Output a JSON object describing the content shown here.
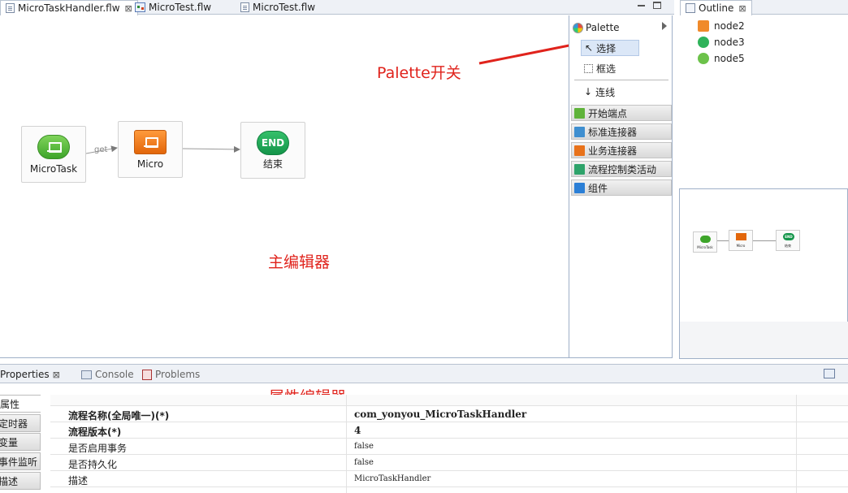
{
  "editor_tabs": [
    {
      "label": "MicroTaskHandler.flw",
      "active": true
    },
    {
      "label": "MicroTest.flw",
      "active": false
    },
    {
      "label": "MicroTest.flw",
      "active": false
    }
  ],
  "canvas": {
    "nodes": [
      {
        "label": "MicroTask"
      },
      {
        "label": "Micro"
      },
      {
        "label": "结束",
        "badge_text": "END"
      }
    ],
    "edge_label": "get",
    "annotation_main": "主编辑器",
    "annotation_palette": "Palette开关"
  },
  "palette": {
    "title": "Palette",
    "tools": [
      "选择",
      "框选",
      "连线"
    ],
    "categories": [
      "开始端点",
      "标准连接器",
      "业务连接器",
      "流程控制类活动",
      "组件"
    ]
  },
  "outline": {
    "title": "Outline",
    "items": [
      "node2",
      "node3",
      "node5"
    ],
    "minimap_labels": [
      "MicroTask",
      "Micro",
      "END",
      "结束"
    ]
  },
  "properties_tabs": [
    {
      "label": "Properties",
      "active": true
    },
    {
      "label": "Console",
      "active": false
    },
    {
      "label": "Problems",
      "active": false
    }
  ],
  "properties": {
    "annotation": "属性编辑器",
    "side_tabs": [
      "属性",
      "定时器",
      "变量",
      "事件监听",
      "描述"
    ],
    "rows": [
      {
        "key": "流程名称(全局唯一)(*)",
        "value": "com_yonyou_MicroTaskHandler"
      },
      {
        "key": "流程版本(*)",
        "value": "4"
      },
      {
        "key": "是否启用事务",
        "value": "false"
      },
      {
        "key": "是否持久化",
        "value": "false"
      },
      {
        "key": "描述",
        "value": "MicroTaskHandler"
      }
    ]
  },
  "colors": {
    "accent_red": "#e0231c",
    "node_green": "#3ea52a",
    "node_orange": "#e2660a",
    "end_green": "#14954a"
  }
}
